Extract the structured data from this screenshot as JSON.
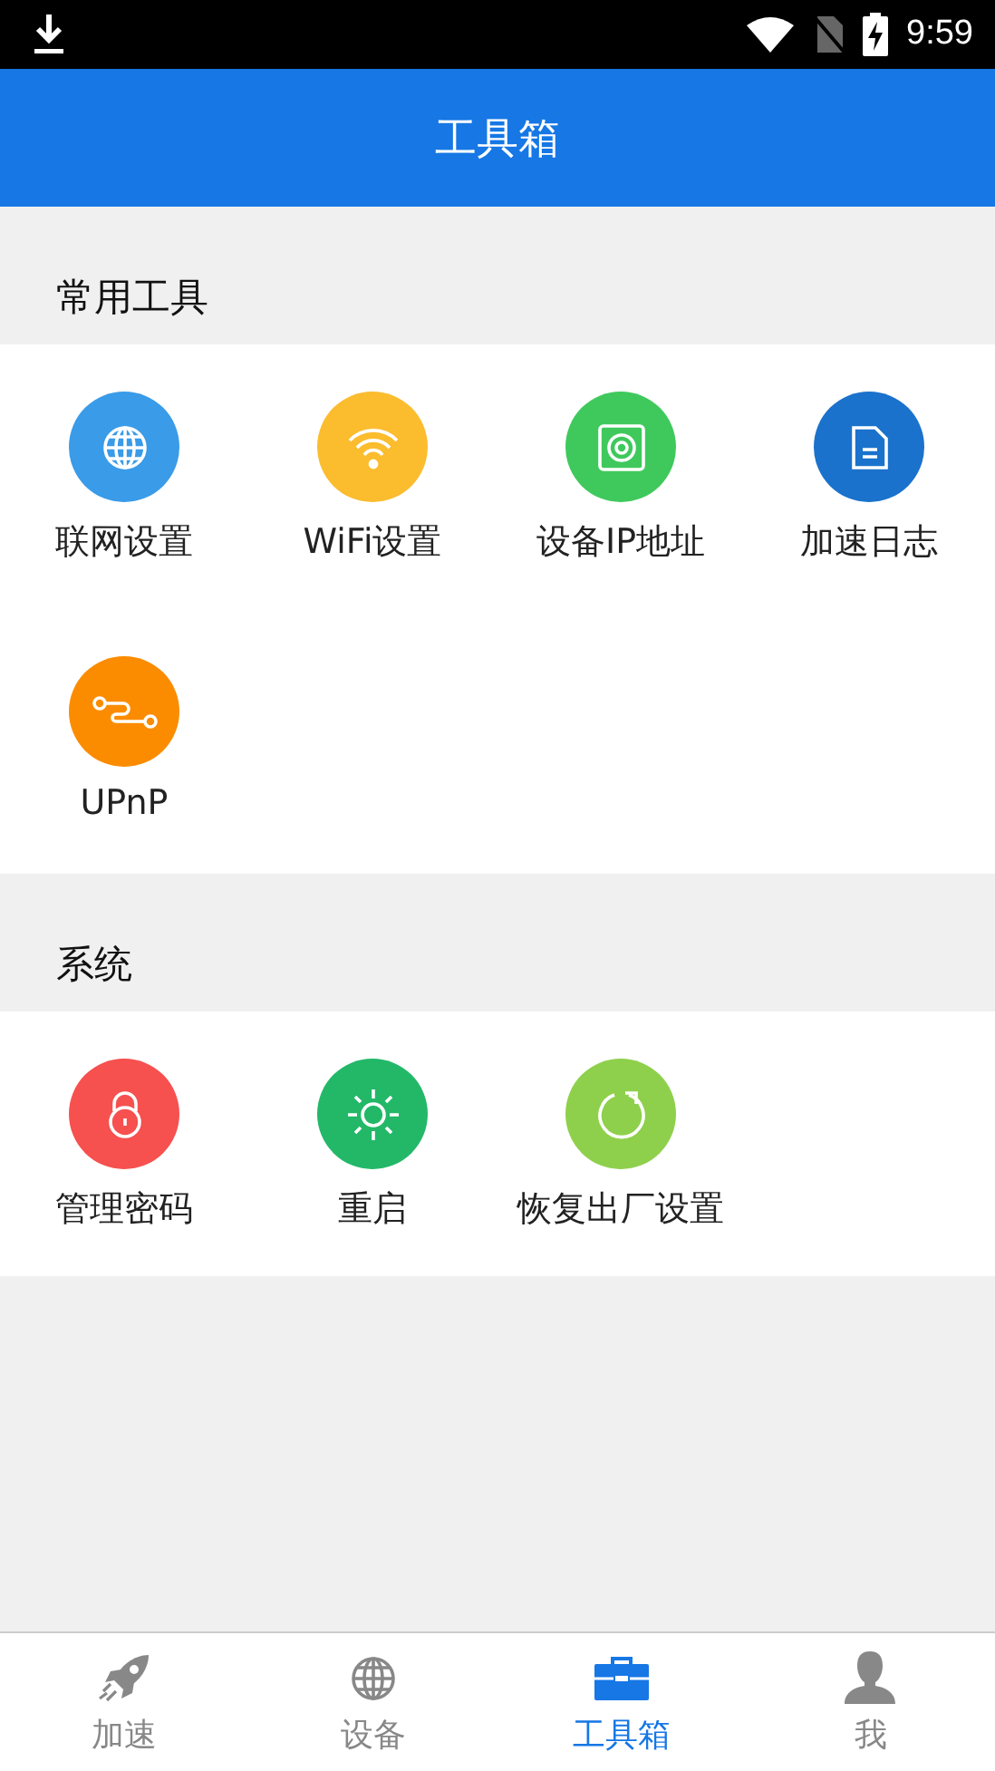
{
  "status_bar": {
    "time": "9:59"
  },
  "header": {
    "title": "工具箱"
  },
  "sections": [
    {
      "title": "常用工具",
      "tools": [
        {
          "label": "联网设置",
          "kind": "globe",
          "color": "#3a9be8"
        },
        {
          "label": "WiFi设置",
          "kind": "wifi",
          "color": "#fbbc2e"
        },
        {
          "label": "设备IP地址",
          "kind": "device",
          "color": "#3fc95c"
        },
        {
          "label": "加速日志",
          "kind": "document",
          "color": "#1a72cc"
        },
        {
          "label": "UPnP",
          "kind": "link",
          "color": "#fb8c00"
        }
      ]
    },
    {
      "title": "系统",
      "tools": [
        {
          "label": "管理密码",
          "kind": "lock",
          "color": "#f6504f"
        },
        {
          "label": "重启",
          "kind": "sun",
          "color": "#22b868"
        },
        {
          "label": "恢复出厂设置",
          "kind": "reset",
          "color": "#8ed04c"
        }
      ]
    }
  ],
  "bottom_nav": [
    {
      "label": "加速",
      "kind": "rocket",
      "selected": false
    },
    {
      "label": "设备",
      "kind": "globe",
      "selected": false
    },
    {
      "label": "工具箱",
      "kind": "toolbox",
      "selected": true
    },
    {
      "label": "我",
      "kind": "person",
      "selected": false
    }
  ]
}
